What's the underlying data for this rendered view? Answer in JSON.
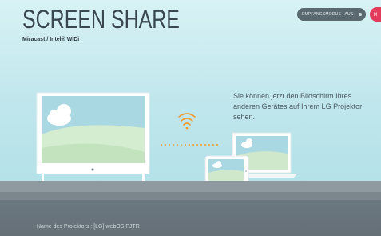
{
  "header": {
    "title": "SCREEN SHARE",
    "subtitle": "Miracast / Intel® WiDi"
  },
  "mode_toggle": {
    "label": "EMPFANGSMODUS : AUS"
  },
  "close_button": {
    "glyph": "×"
  },
  "description": "Sie können jetzt den Bildschirm Ihres anderen Gerätes auf Ihrem LG Projektor sehen.",
  "footer": {
    "projector_name": "Name des Projektors : [LG] webOS PJTR"
  },
  "icons": {
    "wifi": "wifi-signal-icon",
    "cloud": "cloud-icon"
  },
  "colors": {
    "accent_close": "#e23b5c",
    "wifi_orange": "#f39b2a",
    "screen_green": "#cfe9c8",
    "screen_sky": "#9fd1de"
  }
}
